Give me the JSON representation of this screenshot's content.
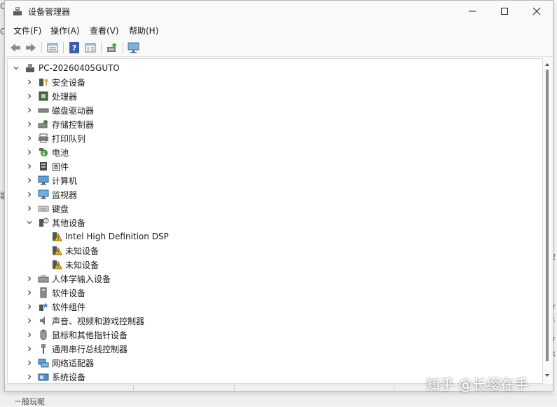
{
  "window": {
    "title": "设备管理器"
  },
  "menu": [
    "文件(F)",
    "操作(A)",
    "查看(V)",
    "帮助(H)"
  ],
  "toolbar_icons": [
    "back-icon",
    "forward-icon",
    "properties-icon",
    "help-icon",
    "details-icon",
    "update-driver-icon",
    "monitor-icon"
  ],
  "tree": {
    "root": "PC-20260405GUTO",
    "categories": [
      {
        "label": "安全设备",
        "icon": "security-device-icon"
      },
      {
        "label": "处理器",
        "icon": "processor-icon"
      },
      {
        "label": "磁盘驱动器",
        "icon": "disk-drive-icon"
      },
      {
        "label": "存储控制器",
        "icon": "storage-controller-icon"
      },
      {
        "label": "打印队列",
        "icon": "printer-icon"
      },
      {
        "label": "电池",
        "icon": "battery-icon"
      },
      {
        "label": "固件",
        "icon": "firmware-icon"
      },
      {
        "label": "计算机",
        "icon": "computer-icon"
      },
      {
        "label": "监视器",
        "icon": "monitor-icon"
      },
      {
        "label": "键盘",
        "icon": "keyboard-icon"
      },
      {
        "label": "其他设备",
        "icon": "other-device-icon",
        "expanded": true,
        "children": [
          {
            "label": "Intel High Definition DSP",
            "icon": "warning-device-icon"
          },
          {
            "label": "未知设备",
            "icon": "warning-device-icon"
          },
          {
            "label": "未知设备",
            "icon": "warning-device-icon"
          }
        ]
      },
      {
        "label": "人体学输入设备",
        "icon": "hid-icon"
      },
      {
        "label": "软件设备",
        "icon": "software-device-icon"
      },
      {
        "label": "软件组件",
        "icon": "software-component-icon"
      },
      {
        "label": "声音、视频和游戏控制器",
        "icon": "sound-icon"
      },
      {
        "label": "鼠标和其他指针设备",
        "icon": "mouse-icon"
      },
      {
        "label": "通用串行总线控制器",
        "icon": "usb-icon"
      },
      {
        "label": "网络适配器",
        "icon": "network-adapter-icon"
      },
      {
        "label": "系统设备",
        "icon": "system-device-icon"
      }
    ]
  },
  "watermark": "知乎 @长缨在手"
}
